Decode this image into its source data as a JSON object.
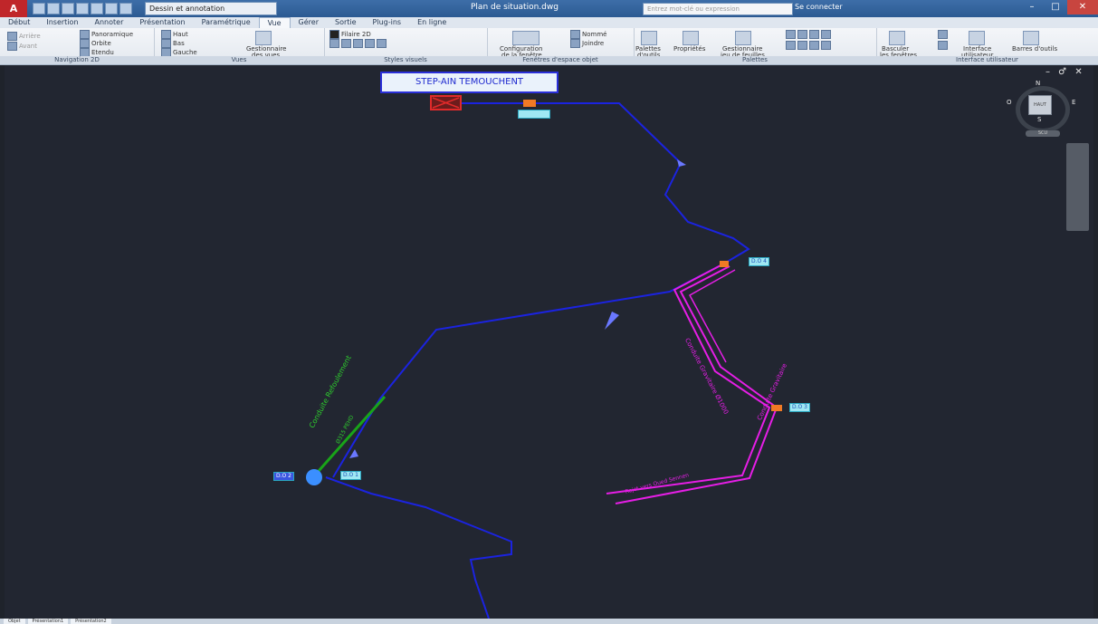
{
  "titlebar": {
    "app_letter": "A",
    "workspace": "Dessin et annotation",
    "doc_title": "Plan de situation.dwg",
    "search_placeholder": "Entrez mot-clé ou expression",
    "signin": "Se connecter",
    "min": "–",
    "max": "□",
    "close": "✕"
  },
  "tabs": [
    "Début",
    "Insertion",
    "Annoter",
    "Présentation",
    "Paramétrique",
    "Vue",
    "Gérer",
    "Sortie",
    "Plug-ins",
    "En ligne"
  ],
  "active_tab": "Vue",
  "ribbon": {
    "nav2d": {
      "title": "Navigation 2D",
      "panoramique": "Panoramique",
      "orbite": "Orbite",
      "etendu": "Etendu",
      "arriere": "Arrière",
      "avant": "Avant"
    },
    "vues": {
      "title": "Vues",
      "haut": "Haut",
      "bas": "Bas",
      "gauche": "Gauche",
      "gestionnaire": "Gestionnaire",
      "des_vues": "des vues"
    },
    "styles": {
      "title": "Styles visuels",
      "filaire": "Filaire 2D"
    },
    "fenetres": {
      "title": "Fenêtres d'espace objet",
      "config": "Configuration",
      "de_fenetre": "de la fenêtre",
      "nomme": "Nommé",
      "joindre": "Joindre"
    },
    "palettes": {
      "title": "Palettes",
      "palettes": "Palettes",
      "doutils": "d'outils",
      "proprietes": "Propriétés",
      "gestionnaire": "Gestionnaire",
      "jeu": "jeu de feuilles"
    },
    "interface": {
      "title": "Interface utilisateur",
      "basculer": "Basculer",
      "les_fenetres": "les fenêtres",
      "interface": "Interface",
      "utilisateur": "utilisateur",
      "barres": "Barres d'outils"
    }
  },
  "drawing": {
    "station_title": "STEP-AIN TEMOUCHENT",
    "tag_top": "",
    "tag_d4": "D.O 4",
    "tag_d3": "D.O 3",
    "tag_d1": "D.O 1",
    "tag_left": "D.O 2",
    "label_green": "Conduite Refoulement",
    "label_green2": "Ø315 PEHD",
    "label_magenta1": "Conduite Gravitaire Ø1000",
    "label_magenta2": "Conduite Gravitaire",
    "label_magenta3": "Rejet vers Oued Sennen"
  },
  "viewcube": {
    "n": "N",
    "s": "S",
    "e": "E",
    "o": "O",
    "face": "HAUT",
    "wcs": "SCU"
  },
  "viewport_controls": "– ♂ ✕",
  "layout_tabs": [
    "Objet",
    "Présentation1",
    "Présentation2"
  ],
  "colors": {
    "bg": "#222631",
    "blue": "#1b23e0",
    "magenta": "#e61ee6",
    "green": "#19a419"
  }
}
